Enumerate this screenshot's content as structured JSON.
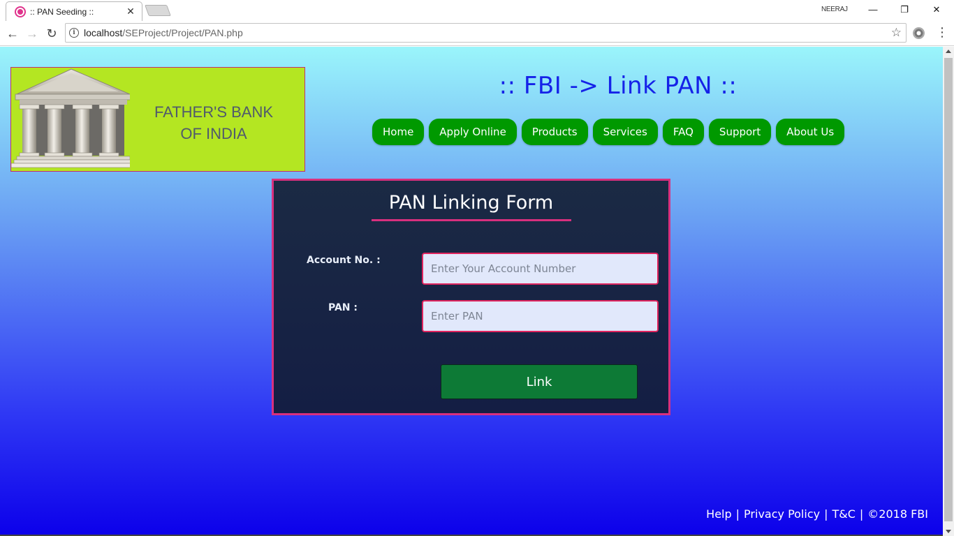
{
  "browser": {
    "tab_title": ":: PAN Seeding ::",
    "tab_close": "✕",
    "profile_name": "NEERAJ",
    "url_host": "localhost",
    "url_path": "/SEProject/Project/PAN.php",
    "window": {
      "minimize": "—",
      "restore": "❐",
      "close": "✕"
    },
    "nav": {
      "back": "←",
      "forward": "→",
      "reload": "↻"
    },
    "star": "☆",
    "menu": "⋮"
  },
  "logo": {
    "line1": "FATHER'S BANK",
    "line2": "OF INDIA"
  },
  "header": {
    "title": ":: FBI -> Link PAN ::"
  },
  "nav": {
    "items": [
      "Home",
      "Apply Online",
      "Products",
      "Services",
      "FAQ",
      "Support",
      "About Us"
    ]
  },
  "form": {
    "title": "PAN Linking Form",
    "account_label": "Account No. :",
    "account_placeholder": "Enter Your Account Number",
    "pan_label": "PAN :",
    "pan_placeholder": "Enter PAN",
    "submit_label": "Link"
  },
  "footer": {
    "help": "Help",
    "sep": "|",
    "privacy": "Privacy Policy",
    "tnc": "T&C",
    "copyright": "©2018 FBI"
  },
  "colors": {
    "nav_green": "#009900",
    "form_border": "#d8307e",
    "title_blue": "#1522e8",
    "logo_bg": "#b4e622"
  }
}
